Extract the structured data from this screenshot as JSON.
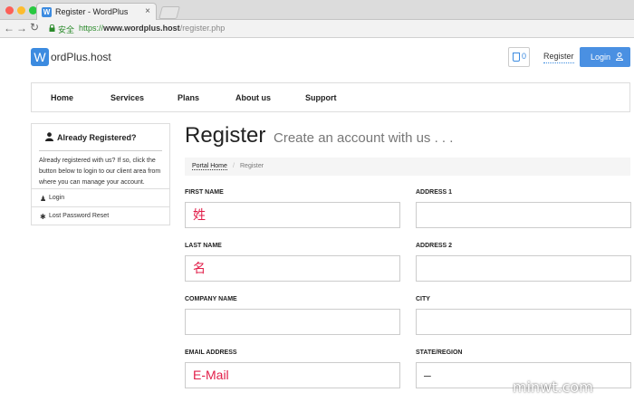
{
  "browser": {
    "tab_title": "Register - WordPlus",
    "tab_favicon": "W",
    "secure_label": "安全",
    "url_https": "https://",
    "url_host": "www.wordplus.host",
    "url_path": "/register.php"
  },
  "header": {
    "logo_letter": "W",
    "logo_text": "ordPlus.host",
    "cart_count": "0",
    "register_label": "Register",
    "login_label": "Login"
  },
  "nav": {
    "items": [
      "Home",
      "Services",
      "Plans",
      "About us",
      "Support"
    ]
  },
  "sidebar": {
    "title": "Already Registered?",
    "text": "Already registered with us? If so, click the button below to login to our client area from where you can manage your account.",
    "rows": [
      {
        "label": "Login",
        "icon": "user-icon"
      },
      {
        "label": "Lost Password Reset",
        "icon": "asterisk-icon"
      }
    ]
  },
  "main": {
    "title": "Register",
    "subtitle": "Create an account with us . . .",
    "breadcrumb_home": "Portal Home",
    "breadcrumb_sep": "/",
    "breadcrumb_current": "Register"
  },
  "form": {
    "first_name_label": "FIRST NAME",
    "first_name_value": "姓",
    "address1_label": "ADDRESS 1",
    "address1_value": "",
    "last_name_label": "LAST NAME",
    "last_name_value": "名",
    "address2_label": "ADDRESS 2",
    "address2_value": "",
    "company_label": "COMPANY NAME",
    "company_value": "",
    "city_label": "CITY",
    "city_value": "",
    "email_label": "EMAIL ADDRESS",
    "email_value": "E-Mail",
    "state_label": "STATE/REGION",
    "state_value": "–"
  },
  "colors": {
    "accent": "#4a90e2",
    "input_text": "#e11d48"
  },
  "watermark": "minwt.com"
}
